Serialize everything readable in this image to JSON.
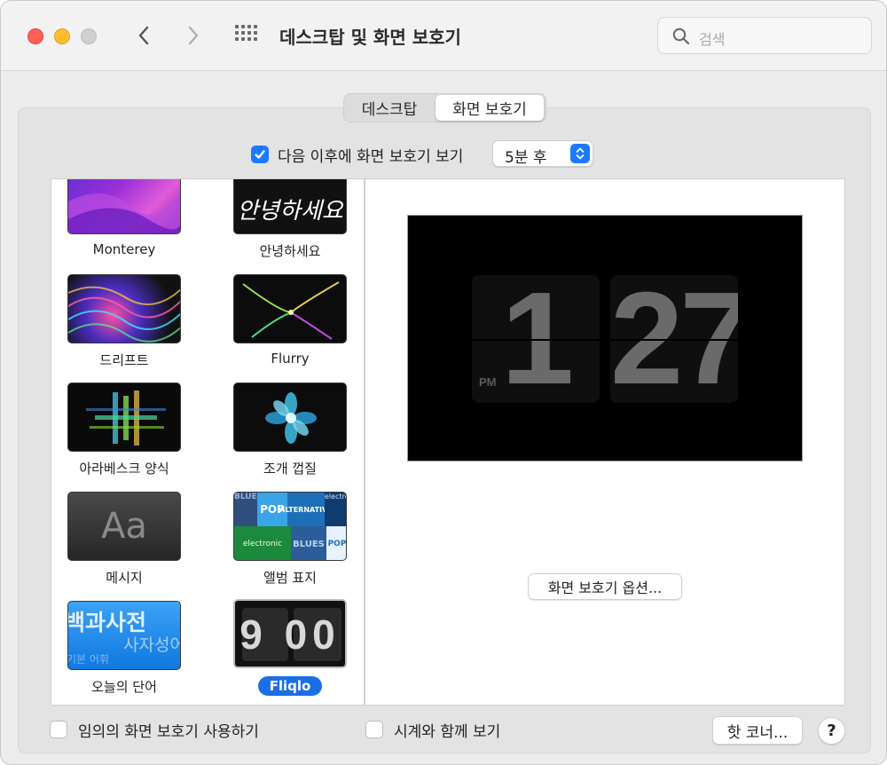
{
  "window": {
    "title": "데스크탑 및 화면 보호기",
    "search_placeholder": "검색"
  },
  "tabs": [
    {
      "label": "데스크탑",
      "selected": false
    },
    {
      "label": "화면 보호기",
      "selected": true
    }
  ],
  "show_after": {
    "checked": true,
    "label": "다음 이후에 화면 보호기 보기",
    "selected_value": "5분 후"
  },
  "savers": [
    {
      "label": "Monterey",
      "icon": "monterey-wallpaper"
    },
    {
      "label": "안녕하세요",
      "icon": "hello-script",
      "thumb_text": "안녕하세요"
    },
    {
      "label": "드리프트",
      "icon": "drift-waves"
    },
    {
      "label": "Flurry",
      "icon": "flurry-strands"
    },
    {
      "label": "아라베스크 양식",
      "icon": "arabesque-pattern"
    },
    {
      "label": "조개 껍질",
      "icon": "shell-flower"
    },
    {
      "label": "메시지",
      "icon": "message-aa",
      "thumb_text": "Aa"
    },
    {
      "label": "앨범 표지",
      "icon": "album-grid",
      "thumb_words": [
        "BLUES",
        "POP",
        "ALTERNATIVE",
        "electronic",
        "electronic",
        "BLUES",
        "POP"
      ]
    },
    {
      "label": "오늘의 단어",
      "icon": "word-of-day",
      "thumb_words": [
        "백과사전",
        "사자성어",
        "기본 어휘"
      ]
    },
    {
      "label": "Fliqlo",
      "icon": "flip-clock",
      "thumb_text": "9 00",
      "selected": true
    }
  ],
  "preview": {
    "hour": "1",
    "minute": "27",
    "ampm": "PM"
  },
  "buttons": {
    "options": "화면 보호기 옵션...",
    "hot_corners": "핫 코너...",
    "help": "?"
  },
  "bottom": {
    "random_label": "임의의 화면 보호기 사용하기",
    "random_checked": false,
    "clock_label": "시계와 함께 보기",
    "clock_checked": false
  },
  "colors": {
    "accent": "#1a7bff",
    "selected_pill": "#1a6fe8"
  }
}
